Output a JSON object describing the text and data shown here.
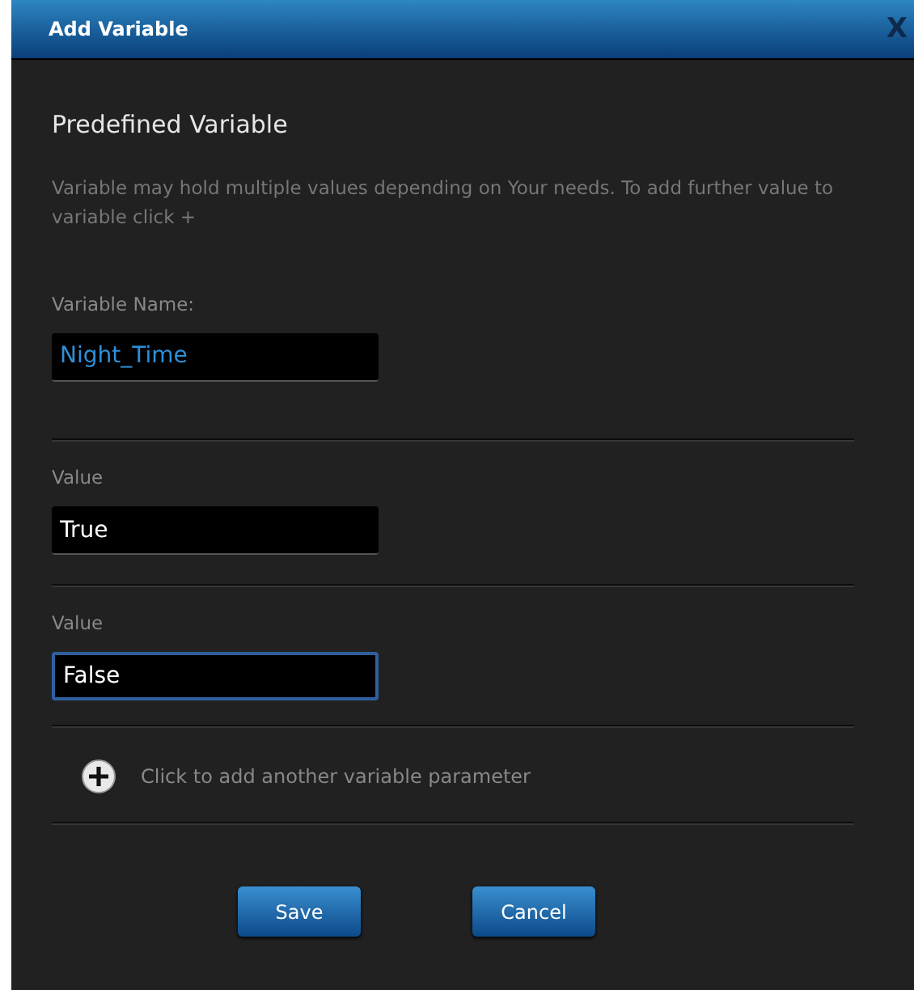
{
  "window": {
    "title": "Add Variable",
    "close": "X"
  },
  "heading": "Predefined Variable",
  "description": "Variable may hold multiple values depending on Your needs. To add further value to variable click +",
  "name_field": {
    "label": "Variable Name:",
    "value": "Night_Time",
    "focused": false
  },
  "values": [
    {
      "label": "Value",
      "value": "True",
      "focused": false
    },
    {
      "label": "Value",
      "value": "False",
      "focused": true
    }
  ],
  "add_row": {
    "text": "Click to add another variable parameter"
  },
  "buttons": [
    {
      "label": "Save"
    },
    {
      "label": "Cancel"
    }
  ]
}
